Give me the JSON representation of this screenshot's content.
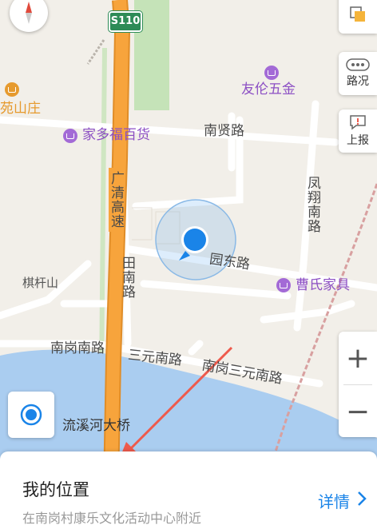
{
  "map": {
    "highway_shield": "S110",
    "pois": {
      "youlun": "友伦五金",
      "jiaduofu": "家多福百货",
      "caoshi": "曹氏家具",
      "yuanshanzhuang": "苑山庄"
    },
    "roads": {
      "nanxian": "南贤路",
      "guangqing": "广清高速",
      "fengxiang": "凤翔南路",
      "yuandong": "园东路",
      "tiannan": "田南路",
      "nangangnan": "南岗南路",
      "sanyuannan": "三元南路",
      "nangangsanyuannan": "南岗三元南路"
    },
    "places": {
      "qiganshan": "棋杆山",
      "bridge": "流溪河大桥"
    },
    "colors": {
      "highway": "#f7a43c",
      "water": "#aacdf0",
      "green": "#c5e3b8",
      "location": "#1a84e8",
      "arrow": "#ee5a4c"
    }
  },
  "controls": {
    "traffic_label": "路况",
    "report_label": "上报",
    "zoom_in": "+",
    "zoom_out": "−"
  },
  "panel": {
    "title": "我的位置",
    "subtitle": "在南岗村康乐文化活动中心附近",
    "detail_label": "详情"
  }
}
